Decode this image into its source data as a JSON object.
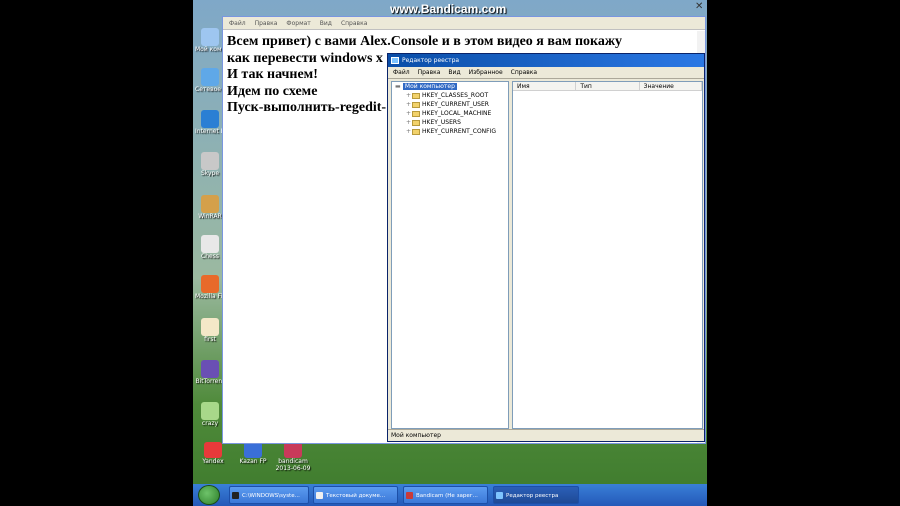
{
  "watermark": "www.Bandicam.com",
  "desktop_icons": [
    {
      "label": "Мой компьютер",
      "color": "#9ec6f0"
    },
    {
      "label": "Сетевое окружение",
      "color": "#5fa8e8"
    },
    {
      "label": "Internet Explorer",
      "color": "#2b7fd4"
    },
    {
      "label": "Skype",
      "color": "#c8c8c8"
    },
    {
      "label": "WinRAR",
      "color": "#d4a04a"
    },
    {
      "label": "Chess",
      "color": "#e8e8e8"
    },
    {
      "label": "Mozilla Firefox",
      "color": "#e86a2a"
    },
    {
      "label": "first",
      "color": "#f4e8c8"
    },
    {
      "label": "BitTorrent",
      "color": "#6a4fb4"
    },
    {
      "label": "crazy",
      "color": "#a8d88a"
    }
  ],
  "bottom_icons": [
    {
      "label": "Yandex",
      "color": "#e83a3a"
    },
    {
      "label": "Kazan FP",
      "color": "#3a6fd8"
    },
    {
      "label": "bandicam",
      "sublabel": "2013-06-09",
      "color": "#c83a5a"
    }
  ],
  "notepad": {
    "menu": [
      "Файл",
      "Правка",
      "Формат",
      "Вид",
      "Справка"
    ],
    "lines": [
      "Всем привет) с вами Alex.Console и в этом видео я вам покажу",
      "как перевести windows x",
      "И так начнем!",
      "Идем по схеме",
      "Пуск-выполнить-regedit-"
    ]
  },
  "regedit": {
    "title": "Редактор реестра",
    "menu": [
      "Файл",
      "Правка",
      "Вид",
      "Избранное",
      "Справка"
    ],
    "tree_root": "Мой компьютер",
    "tree_items": [
      "HKEY_CLASSES_ROOT",
      "HKEY_CURRENT_USER",
      "HKEY_LOCAL_MACHINE",
      "HKEY_USERS",
      "HKEY_CURRENT_CONFIG"
    ],
    "columns": [
      "Имя",
      "Тип",
      "Значение"
    ],
    "status": "Мой компьютер"
  },
  "taskbar": {
    "buttons": [
      {
        "label": "C:\\WINDOWS\\syste...",
        "color": "#222"
      },
      {
        "label": "Текстовый докуме...",
        "color": "#f0f0f0"
      },
      {
        "label": "Bandicam (Не зарег...",
        "color": "#c83a3a"
      },
      {
        "label": "Редактор реестра",
        "color": "#7ec4ff",
        "active": true
      }
    ]
  }
}
